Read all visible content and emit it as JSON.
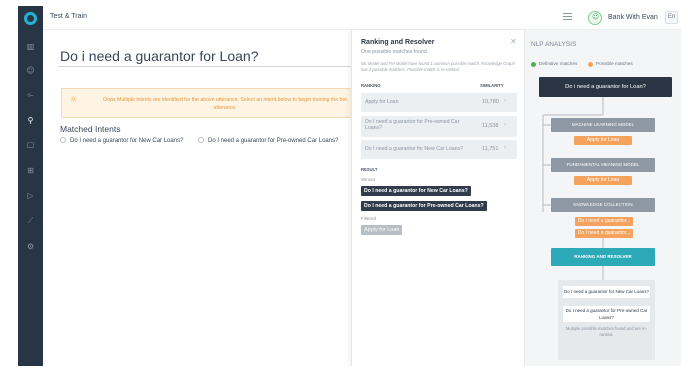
{
  "app": {
    "title": "Test & Train"
  },
  "topbar": {
    "bot_name": "Bank With Evan",
    "bot_icon": "robot-icon",
    "lang": "En"
  },
  "sidebar": {
    "icons": [
      "bar-chart-icon",
      "bot-icon",
      "flow-icon",
      "wrench-icon",
      "chat-icon",
      "grid-icon",
      "play-icon",
      "analytics-icon",
      "settings-icon"
    ]
  },
  "main": {
    "utterance": "Do i need a guarantor for Loan?",
    "warning_line1": "Oops Multiple intents are identified for the above utterance. Select an intent below to begin training the bot",
    "warning_line2": "utterance.",
    "matched_title": "Matched Intents",
    "matched": [
      "Do I need a guarantor for New Car Loans?",
      "Do I need a guarantor for Pre-owned Car Loans?"
    ]
  },
  "ranking": {
    "title": "Ranking and Resolver",
    "subtitle": "One possible matches found.",
    "description": "ML Model and FM Model have found 1 common possible match. Knowledge Graph has 2 possible matches. Possible match is re-ranked.",
    "col_ranking": "RANKING",
    "col_similarity": "SIMILARITY",
    "rows": [
      {
        "label": "Apply for Loan",
        "value": "10,780"
      },
      {
        "label": "Do I need a guarantor for Pre-owned Car Loans?",
        "value": "11,538"
      },
      {
        "label": "Do I need a guarantor for New Car Loans?",
        "value": "11,751"
      }
    ],
    "result_label": "RESULT",
    "winner_label": "Winner",
    "winners": [
      "Do I need a guarantor for New Car Loans?",
      "Do I need a guarantor for Pre-owned Car Loans?"
    ],
    "filtered_label": "Filtered",
    "filtered": [
      "Apply for Loan"
    ]
  },
  "nlp": {
    "title": "NLP ANALYSIS",
    "legend_definitive": "Definitive matches",
    "legend_possible": "Possible matches",
    "colors": {
      "definitive": "#4caf50",
      "possible": "#f4a25e",
      "dark": "#2b3644",
      "teal": "#2daab8"
    },
    "utterance": "Do i need a guarantor for Loan?",
    "ml_label": "MACHINE LEARNING MODEL",
    "ml_match": "Apply for Loan",
    "fm_label": "FUNDAMENTAL MEANING MODEL",
    "fm_match": "Apply for Loan",
    "kg_label": "KNOWLEDGE COLLECTION",
    "kg_matches": [
      "Do I need a guarantor...",
      "Do I need a guarantor..."
    ],
    "rr_label": "RANKING AND RESOLVER",
    "out_1": "Do I need a guarantor for New Car Loans?",
    "out_2": "Do I need a guarantor for Pre-owned Car Loans?",
    "out_note": "Multiple possible matches found and are re-ranked."
  }
}
